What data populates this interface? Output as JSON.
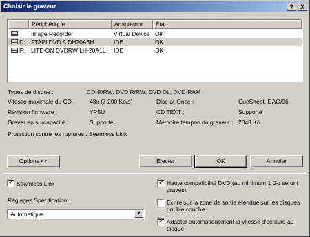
{
  "window": {
    "title": "Choisir le graveur",
    "help_label": "?",
    "close_label": "X"
  },
  "drives": {
    "columns": [
      "Périphérique",
      "Adaptateur",
      "État"
    ],
    "rows": [
      {
        "letter": "",
        "name": "Image Recorder",
        "adapter": "Virtual Device",
        "state": "OK"
      },
      {
        "letter": "D:",
        "name": "ATAPI DVD A  DH20A3H",
        "adapter": "IDE",
        "state": "OK"
      },
      {
        "letter": "F:",
        "name": "LITE-ON DVDRW LH-20A1L",
        "adapter": "IDE",
        "state": "OK"
      }
    ]
  },
  "info": {
    "disc_types_label": "Types de disque :",
    "disc_types_value": "CD-R/RW; DVD R/RW; DVD DL; DVD-RAM",
    "max_speed_label": "Vitesse maximale du CD :",
    "max_speed_value": "48x (7 200 Ko/s)",
    "dao_label": "Disc-at-Once :",
    "dao_value": "CueSheet, DAO/96",
    "firmware_label": "Révision firmware :",
    "firmware_value": "YP5U",
    "cdtext_label": "CD TEXT :",
    "cdtext_value": "Supporté",
    "overburn_label": "Graver en surcapacité :",
    "overburn_value": "Supporté",
    "buffer_label": "Mémoire tampon du graveur :",
    "buffer_value": "2048 Ko",
    "protection_label": "Protection contre les ruptures :",
    "protection_value": "Seamless Link"
  },
  "buttons": {
    "options": "Options <<",
    "eject": "Éjecter",
    "ok": "OK",
    "cancel": "Annuler"
  },
  "options": {
    "seamless_link": "Seamless Link",
    "settings_label": "Réglages Spécification :",
    "settings_value": "Automatique",
    "dvd_compat": "Haute compatibilité DVD (au minimum 1 Go seront gravés)",
    "extended_leadout": "Écrire sur la zone de sortie étendue sur les disques double couche",
    "auto_speed": "Adapter automatiquement la vitesse d'écriture au disque"
  },
  "state": {
    "seamless_link_checked": true,
    "dvd_compat_checked": true,
    "extended_leadout_checked": false,
    "auto_speed_checked": true,
    "selected_row": 1
  }
}
